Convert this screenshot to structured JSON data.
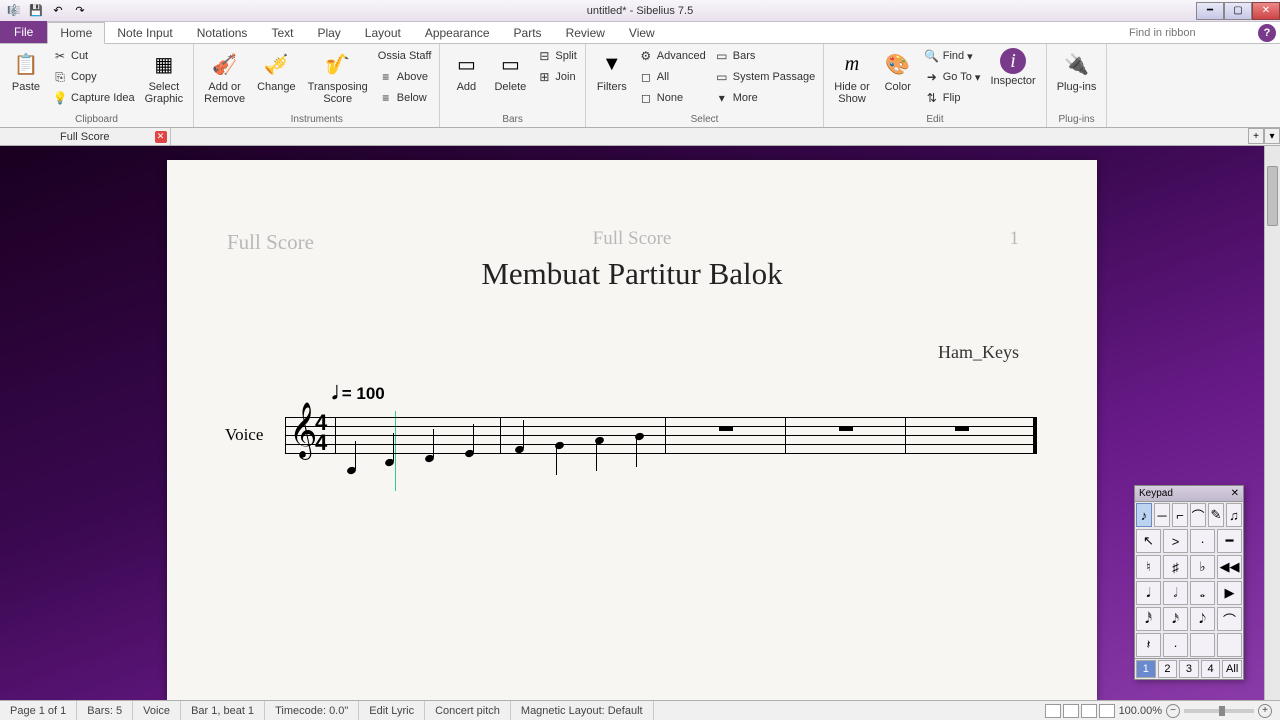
{
  "window": {
    "title": "untitled* - Sibelius 7.5"
  },
  "tabs": {
    "file": "File",
    "list": [
      "Home",
      "Note Input",
      "Notations",
      "Text",
      "Play",
      "Layout",
      "Appearance",
      "Parts",
      "Review",
      "View"
    ],
    "active": "Home",
    "search_placeholder": "Find in ribbon"
  },
  "ribbon": {
    "clipboard": {
      "label": "Clipboard",
      "paste": "Paste",
      "cut": "Cut",
      "copy": "Copy",
      "capture": "Capture Idea",
      "select_graphic": "Select\nGraphic"
    },
    "instruments": {
      "label": "Instruments",
      "add_remove": "Add or\nRemove",
      "change": "Change",
      "transposing": "Transposing\nScore",
      "ossia": "Ossia Staff",
      "above": "Above",
      "below": "Below"
    },
    "bars": {
      "label": "Bars",
      "add": "Add",
      "delete": "Delete",
      "split": "Split",
      "join": "Join"
    },
    "select": {
      "label": "Select",
      "filters": "Filters",
      "advanced": "Advanced",
      "all": "All",
      "none": "None",
      "bars_btn": "Bars",
      "system_passage": "System Passage",
      "more": "More"
    },
    "edit": {
      "label": "Edit",
      "hide_show": "Hide or\nShow",
      "color": "Color",
      "find": "Find",
      "goto": "Go To",
      "flip": "Flip",
      "inspector": "Inspector"
    },
    "plugins": {
      "label": "Plug-ins",
      "plugins_btn": "Plug-ins"
    }
  },
  "doc_tab": "Full Score",
  "score": {
    "header_left": "Full Score",
    "header_center": "Full Score",
    "header_right": "1",
    "title": "Membuat Partitur Balok",
    "composer": "Ham_Keys",
    "tempo": "= 100",
    "instrument": "Voice",
    "time_sig_top": "4",
    "time_sig_bot": "4"
  },
  "keypad": {
    "title": "Keypad",
    "voices": [
      "1",
      "2",
      "3",
      "4",
      "All"
    ]
  },
  "status": {
    "page": "Page 1 of 1",
    "bars": "Bars: 5",
    "inst": "Voice",
    "pos": "Bar 1, beat 1",
    "timecode": "Timecode: 0.0\"",
    "editlyric": "Edit Lyric",
    "concert": "Concert pitch",
    "maglayout": "Magnetic Layout: Default",
    "zoom": "100.00%"
  }
}
